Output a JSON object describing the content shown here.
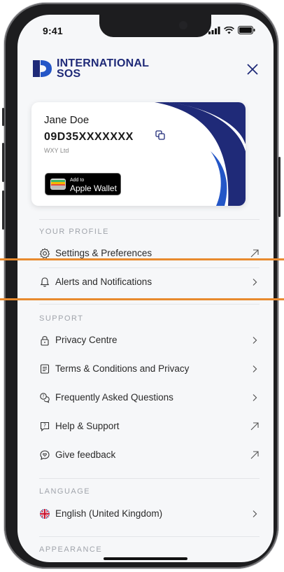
{
  "status": {
    "time": "9:41"
  },
  "header": {
    "brand_line1": "INTERNATIONAL",
    "brand_line2": "SOS"
  },
  "card": {
    "name": "Jane Doe",
    "member_id": "09D35XXXXXXX",
    "company": "WXY Ltd",
    "wallet_small": "Add to",
    "wallet_big": "Apple Wallet"
  },
  "sections": {
    "profile": "YOUR PROFILE",
    "support": "SUPPORT",
    "language": "LANGUAGE",
    "appearance": "APPEARANCE"
  },
  "menu": {
    "settings": "Settings & Preferences",
    "alerts": "Alerts and Notifications",
    "privacy": "Privacy Centre",
    "terms": "Terms & Conditions and Privacy",
    "faq": "Frequently Asked Questions",
    "help": "Help & Support",
    "feedback": "Give feedback",
    "language": "English (United Kingdom)"
  },
  "colors": {
    "brand": "#1f2a78",
    "highlight": "#e88a2e"
  }
}
